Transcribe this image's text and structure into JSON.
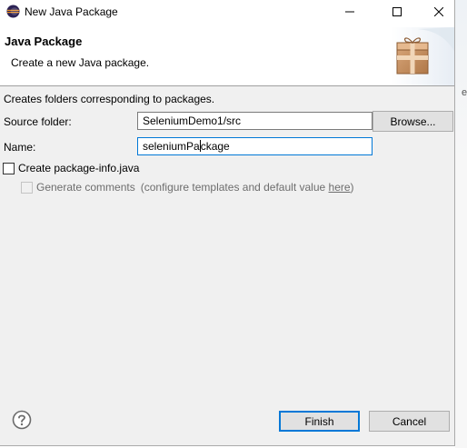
{
  "window": {
    "title": "New Java Package",
    "icon": "eclipse-icon",
    "controls": [
      "minimize-icon",
      "maximize-icon",
      "close-icon"
    ]
  },
  "header": {
    "title": "Java Package",
    "description": "Create a new Java package.",
    "banner_icon": "package-icon"
  },
  "form": {
    "info": "Creates folders corresponding to packages.",
    "source_folder": {
      "label": "Source folder:",
      "value": "SeleniumDemo1/src",
      "browse_label": "Browse..."
    },
    "name": {
      "label": "Name:",
      "value_before_caret": "seleniumPa",
      "value_after_caret": "ckage"
    },
    "create_package_info": {
      "label": "Create package-info.java",
      "checked": false
    },
    "generate_comments": {
      "label": "Generate comments",
      "hint_prefix": "(configure templates and default value ",
      "hint_link": "here",
      "hint_suffix": ")",
      "checked": false,
      "enabled": false
    }
  },
  "footer": {
    "help_icon": "help-icon",
    "finish_label": "Finish",
    "cancel_label": "Cancel"
  },
  "background": {
    "fragment_text": "er"
  },
  "colors": {
    "focus": "#0078d7",
    "dialog_bg": "#f0f0f0",
    "button_bg": "#e1e1e1"
  }
}
